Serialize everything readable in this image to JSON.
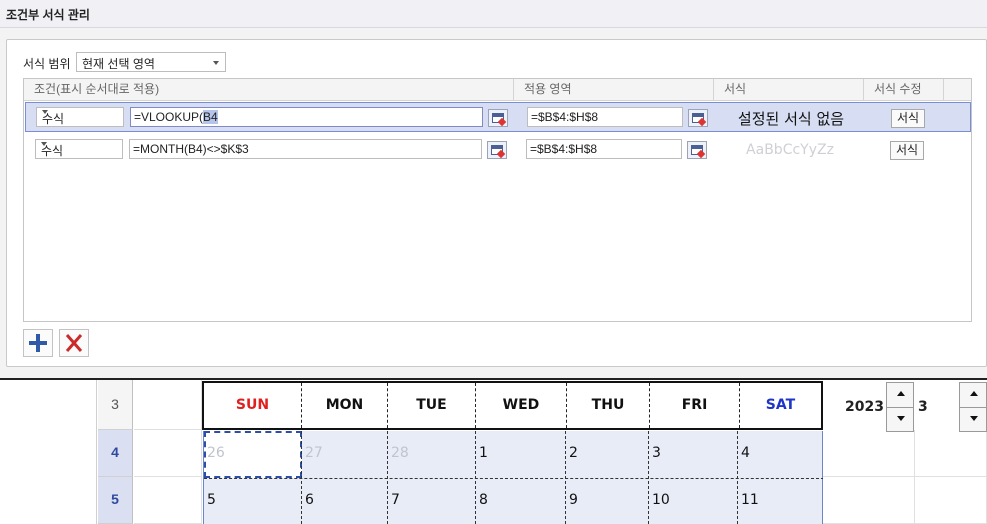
{
  "dialog": {
    "title": "조건부 서식 관리",
    "range_label": "서식 범위",
    "range_value": "현재 선택 영역",
    "columns": [
      "조건(표시 순서대로 적용)",
      "적용 영역",
      "서식",
      "서식 수정"
    ],
    "rules": [
      {
        "type": "수식",
        "formula_plain": "=VLOOKUP(",
        "formula_highlight": "B4",
        "applies_to": "=$B$4:$H$8",
        "preview": "설정된 서식 없음",
        "format_button": "서식"
      },
      {
        "type": "수식",
        "formula": "=MONTH(B4)<>$K$3",
        "applies_to": "=$B$4:$H$8",
        "preview": "AaBbCcYyZz",
        "format_button": "서식"
      }
    ],
    "add_icon": "plus-icon",
    "delete_icon": "x-icon"
  },
  "sheet": {
    "row_headers": [
      "3",
      "4",
      "5"
    ],
    "days": [
      "SUN",
      "MON",
      "TUE",
      "WED",
      "THU",
      "FRI",
      "SAT"
    ],
    "day_colors": {
      "SUN": "#e02020",
      "SAT": "#1f35c8",
      "default": "#111111"
    },
    "week1": [
      "26",
      "27",
      "28",
      "1",
      "2",
      "3",
      "4"
    ],
    "week2": [
      "5",
      "6",
      "7",
      "8",
      "9",
      "10",
      "11"
    ],
    "year": "2023",
    "month": "3"
  }
}
